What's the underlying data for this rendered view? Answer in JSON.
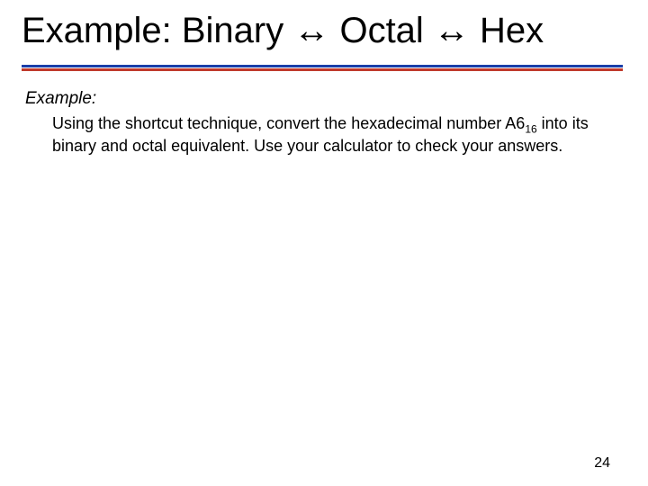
{
  "title": "Example: Binary ↔ Octal ↔ Hex",
  "example_label": "Example:",
  "prompt_pre": "Using the shortcut technique, convert the hexadecimal number A6",
  "prompt_sub": "16",
  "prompt_post": " into its binary and octal equivalent. Use your calculator to check your answers.",
  "page_number": "24"
}
